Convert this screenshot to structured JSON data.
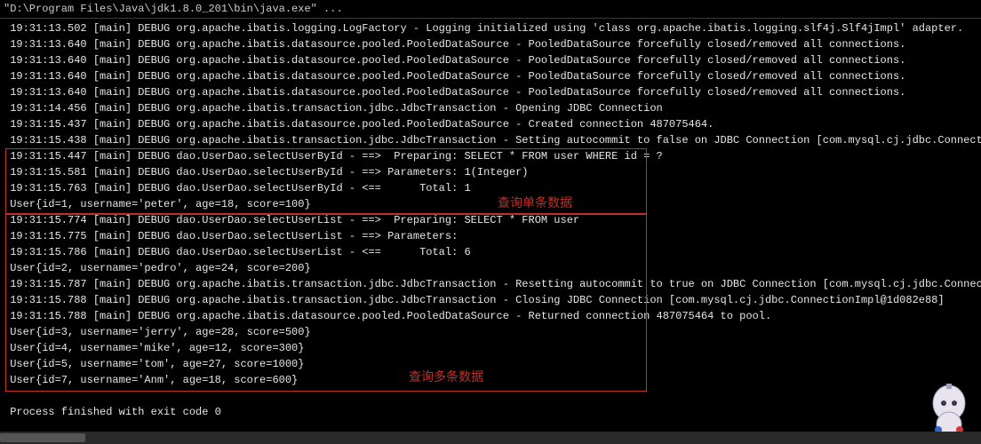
{
  "titlebar": "\"D:\\Program Files\\Java\\jdk1.8.0_201\\bin\\java.exe\" ...",
  "annotations": {
    "box1_label": "查询单条数据",
    "box2_label": "查询多条数据"
  },
  "lines": [
    " 19:31:13.502 [main] DEBUG org.apache.ibatis.logging.LogFactory - Logging initialized using 'class org.apache.ibatis.logging.slf4j.Slf4jImpl' adapter.",
    " 19:31:13.640 [main] DEBUG org.apache.ibatis.datasource.pooled.PooledDataSource - PooledDataSource forcefully closed/removed all connections.",
    " 19:31:13.640 [main] DEBUG org.apache.ibatis.datasource.pooled.PooledDataSource - PooledDataSource forcefully closed/removed all connections.",
    " 19:31:13.640 [main] DEBUG org.apache.ibatis.datasource.pooled.PooledDataSource - PooledDataSource forcefully closed/removed all connections.",
    " 19:31:13.640 [main] DEBUG org.apache.ibatis.datasource.pooled.PooledDataSource - PooledDataSource forcefully closed/removed all connections.",
    " 19:31:14.456 [main] DEBUG org.apache.ibatis.transaction.jdbc.JdbcTransaction - Opening JDBC Connection",
    " 19:31:15.437 [main] DEBUG org.apache.ibatis.datasource.pooled.PooledDataSource - Created connection 487075464.",
    " 19:31:15.438 [main] DEBUG org.apache.ibatis.transaction.jdbc.JdbcTransaction - Setting autocommit to false on JDBC Connection [com.mysql.cj.jdbc.ConnectionI",
    " 19:31:15.447 [main] DEBUG dao.UserDao.selectUserById - ==>  Preparing: SELECT * FROM user WHERE id = ?",
    " 19:31:15.581 [main] DEBUG dao.UserDao.selectUserById - ==> Parameters: 1(Integer)",
    " 19:31:15.763 [main] DEBUG dao.UserDao.selectUserById - <==      Total: 1",
    " User{id=1, username='peter', age=18, score=100}",
    " 19:31:15.774 [main] DEBUG dao.UserDao.selectUserList - ==>  Preparing: SELECT * FROM user",
    " 19:31:15.775 [main] DEBUG dao.UserDao.selectUserList - ==> Parameters: ",
    " 19:31:15.786 [main] DEBUG dao.UserDao.selectUserList - <==      Total: 6",
    " User{id=2, username='pedro', age=24, score=200}",
    " 19:31:15.787 [main] DEBUG org.apache.ibatis.transaction.jdbc.JdbcTransaction - Resetting autocommit to true on JDBC Connection [com.mysql.cj.jdbc.Connection",
    " 19:31:15.788 [main] DEBUG org.apache.ibatis.transaction.jdbc.JdbcTransaction - Closing JDBC Connection [com.mysql.cj.jdbc.ConnectionImpl@1d082e88]",
    " 19:31:15.788 [main] DEBUG org.apache.ibatis.datasource.pooled.PooledDataSource - Returned connection 487075464 to pool.",
    " User{id=3, username='jerry', age=28, score=500}",
    " User{id=4, username='mike', age=12, score=300}",
    " User{id=5, username='tom', age=27, score=1000}",
    " User{id=7, username='Anm', age=18, score=600}",
    "",
    " Process finished with exit code 0"
  ]
}
